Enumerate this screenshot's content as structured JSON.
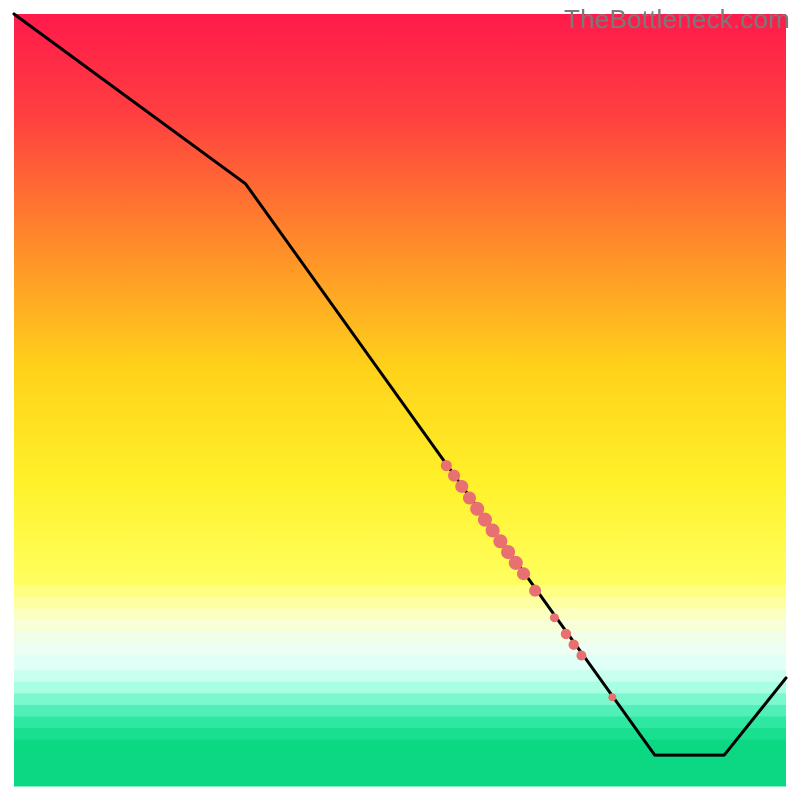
{
  "watermark": "TheBottleneck.com",
  "chart_data": {
    "type": "line",
    "xlim": [
      0,
      100
    ],
    "ylim": [
      0,
      100
    ],
    "line": [
      {
        "x": 0,
        "y": 100
      },
      {
        "x": 30,
        "y": 78
      },
      {
        "x": 83,
        "y": 4
      },
      {
        "x": 92,
        "y": 4
      },
      {
        "x": 100,
        "y": 14
      }
    ],
    "markers": [
      {
        "x": 56.0,
        "y": 41.5,
        "r": 5.5
      },
      {
        "x": 57.0,
        "y": 40.2,
        "r": 6.0
      },
      {
        "x": 58.0,
        "y": 38.8,
        "r": 6.5
      },
      {
        "x": 59.0,
        "y": 37.3,
        "r": 6.5
      },
      {
        "x": 60.0,
        "y": 35.9,
        "r": 7.0
      },
      {
        "x": 61.0,
        "y": 34.5,
        "r": 7.0
      },
      {
        "x": 62.0,
        "y": 33.1,
        "r": 7.0
      },
      {
        "x": 63.0,
        "y": 31.7,
        "r": 7.0
      },
      {
        "x": 64.0,
        "y": 30.3,
        "r": 7.0
      },
      {
        "x": 65.0,
        "y": 28.9,
        "r": 7.0
      },
      {
        "x": 66.0,
        "y": 27.5,
        "r": 6.5
      },
      {
        "x": 67.5,
        "y": 25.3,
        "r": 6.0
      },
      {
        "x": 70.0,
        "y": 21.8,
        "r": 4.5
      },
      {
        "x": 71.5,
        "y": 19.7,
        "r": 5.2
      },
      {
        "x": 72.5,
        "y": 18.3,
        "r": 5.2
      },
      {
        "x": 73.5,
        "y": 16.9,
        "r": 5.0
      },
      {
        "x": 77.5,
        "y": 11.5,
        "r": 4.0
      }
    ],
    "gradient_bands": [
      {
        "y0": 0,
        "y1": 0.74,
        "stops": [
          {
            "offset": 0.0,
            "color": "#ff1a4b"
          },
          {
            "offset": 0.18,
            "color": "#ff4040"
          },
          {
            "offset": 0.4,
            "color": "#ff8a2a"
          },
          {
            "offset": 0.62,
            "color": "#ffd21a"
          },
          {
            "offset": 0.82,
            "color": "#fff12a"
          },
          {
            "offset": 1.0,
            "color": "#ffff60"
          }
        ]
      },
      {
        "y0": 0.74,
        "y1": 0.755,
        "color": "#ffff80"
      },
      {
        "y0": 0.755,
        "y1": 0.77,
        "color": "#fdffa2"
      },
      {
        "y0": 0.77,
        "y1": 0.785,
        "color": "#fbffc0"
      },
      {
        "y0": 0.785,
        "y1": 0.8,
        "color": "#f8ffd8"
      },
      {
        "y0": 0.8,
        "y1": 0.815,
        "color": "#f2ffe8"
      },
      {
        "y0": 0.815,
        "y1": 0.83,
        "color": "#ecfff2"
      },
      {
        "y0": 0.83,
        "y1": 0.85,
        "color": "#e0fff6"
      },
      {
        "y0": 0.85,
        "y1": 0.865,
        "color": "#c8ffee"
      },
      {
        "y0": 0.865,
        "y1": 0.88,
        "color": "#a8ffe2"
      },
      {
        "y0": 0.88,
        "y1": 0.895,
        "color": "#7cf8ce"
      },
      {
        "y0": 0.895,
        "y1": 0.91,
        "color": "#52f0b8"
      },
      {
        "y0": 0.91,
        "y1": 0.925,
        "color": "#2ee8a2"
      },
      {
        "y0": 0.925,
        "y1": 0.94,
        "color": "#18e090"
      },
      {
        "y0": 0.94,
        "y1": 1.0,
        "color": "#0cd884"
      }
    ],
    "marker_color": "#e87070",
    "line_color": "#000000",
    "plot_margin": {
      "left": 14,
      "right": 14,
      "top": 14,
      "bottom": 14
    }
  }
}
